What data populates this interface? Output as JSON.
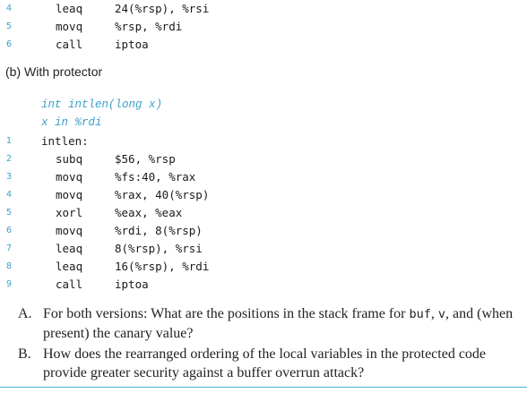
{
  "top_listing": [
    {
      "line": "4",
      "instr": "leaq",
      "operands": "24(%rsp), %rsi"
    },
    {
      "line": "5",
      "instr": "movq",
      "operands": "%rsp, %rdi"
    },
    {
      "line": "6",
      "instr": "call",
      "operands": "iptoa"
    }
  ],
  "section_b": {
    "heading": "(b) With protector",
    "prototype_comment": "int intlen(long x)",
    "arg_comment": "x in %rdi",
    "label_line": "1",
    "label": "intlen:",
    "lines": [
      {
        "line": "2",
        "instr": "subq",
        "operands": "$56, %rsp"
      },
      {
        "line": "3",
        "instr": "movq",
        "operands": "%fs:40, %rax"
      },
      {
        "line": "4",
        "instr": "movq",
        "operands": "%rax, 40(%rsp)"
      },
      {
        "line": "5",
        "instr": "xorl",
        "operands": "%eax, %eax"
      },
      {
        "line": "6",
        "instr": "movq",
        "operands": "%rdi, 8(%rsp)"
      },
      {
        "line": "7",
        "instr": "leaq",
        "operands": "8(%rsp), %rsi"
      },
      {
        "line": "8",
        "instr": "leaq",
        "operands": "16(%rsp), %rdi"
      },
      {
        "line": "9",
        "instr": "call",
        "operands": "iptoa"
      }
    ]
  },
  "questions": {
    "a": {
      "letter": "A.",
      "before": "For both versions: What are the positions in the stack frame for ",
      "code1": "buf",
      "sep1": ", ",
      "code2": "v",
      "after": ", and (when present) the canary value?"
    },
    "b": {
      "letter": "B.",
      "text": "How does the rearranged ordering of the local variables in the protected code provide greater security against a buffer overrun attack?"
    }
  }
}
